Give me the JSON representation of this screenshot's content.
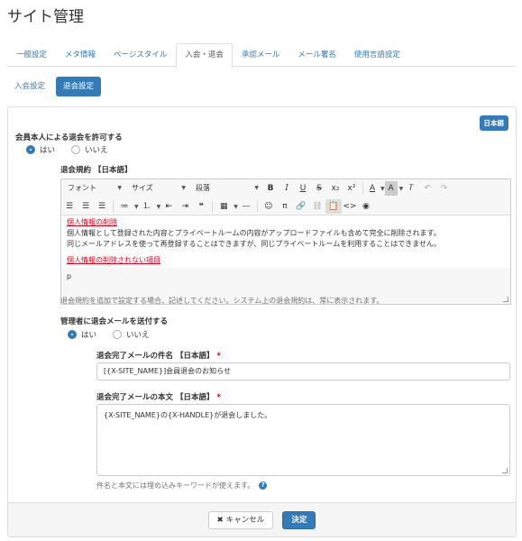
{
  "page": {
    "title": "サイト管理"
  },
  "tabs": [
    {
      "label": "一般設定"
    },
    {
      "label": "メタ情報"
    },
    {
      "label": "ページスタイル"
    },
    {
      "label": "入会・退会",
      "active": true
    },
    {
      "label": "承認メール"
    },
    {
      "label": "メール署名"
    },
    {
      "label": "使用言語設定"
    }
  ],
  "subtabs": [
    {
      "label": "入会設定"
    },
    {
      "label": "退会設定",
      "active": true
    }
  ],
  "lang_badge": "日本語",
  "self_withdraw": {
    "label": "会員本人による退会を許可する",
    "yes": "はい",
    "no": "いいえ"
  },
  "terms": {
    "label": "退会規約 【日本語】",
    "toolbar": {
      "font": "フォント",
      "size": "サイズ",
      "paragraph": "段落",
      "bold": "B",
      "italic": "I",
      "underline": "U",
      "strike": "S",
      "subscript": "x₂",
      "superscript": "x²",
      "font_color": "A",
      "bg_color": "A",
      "quote": "❝",
      "pi": "π",
      "code": "<>"
    },
    "content": {
      "head1": "個人情報の削除",
      "line1": "個人情報として登録された内容とプライベートルームの内容がアップロードファイルも含めて完全に削除されます。",
      "line2": "同じメールアドレスを使って再登録することはできますが、同じプライベートルームを利用することはできません。",
      "head2": "個人情報の削除されない項目"
    },
    "path": "p",
    "help": "退会規約を追加で設定する場合、記述してください。システム上の退会規約は、常に表示されます。"
  },
  "notify": {
    "label": "管理者に退会メールを送付する",
    "yes": "はい",
    "no": "いいえ"
  },
  "mail_subject": {
    "label": "退会完了メールの件名 【日本語】",
    "required": "*",
    "value": "[{X-SITE_NAME}]会員退会のお知らせ"
  },
  "mail_body": {
    "label": "退会完了メールの本文 【日本語】",
    "required": "*",
    "value": "{X-SITE_NAME}の{X-HANDLE}が退会しました。"
  },
  "embed_help": "件名と本文には埋め込みキーワードが使えます。",
  "footer": {
    "cancel": "キャンセル",
    "submit": "決定"
  }
}
